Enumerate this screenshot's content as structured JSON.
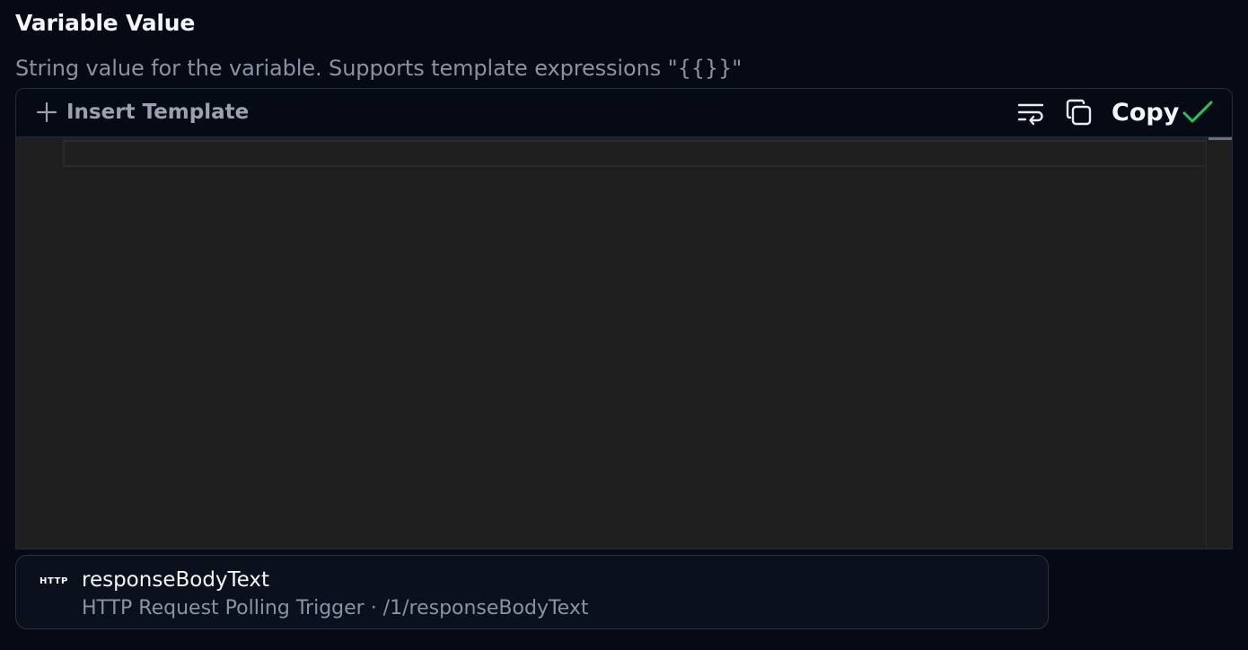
{
  "field": {
    "label": "Variable Value",
    "description": "String value for the variable. Supports template expressions \"{{}}\""
  },
  "toolbar": {
    "insert_template_label": "Insert Template",
    "insert_icon": "plus-icon",
    "wrap_icon": "word-wrap-icon",
    "copy_icon": "copy-icon",
    "copy_label": "Copy",
    "copied_icon": "check-icon",
    "copied_color": "#22c55e"
  },
  "editor": {
    "value": ""
  },
  "suggestion": {
    "badge": "HTTP",
    "name": "responseBodyText",
    "path": "HTTP Request Polling Trigger · /1/responseBodyText"
  }
}
